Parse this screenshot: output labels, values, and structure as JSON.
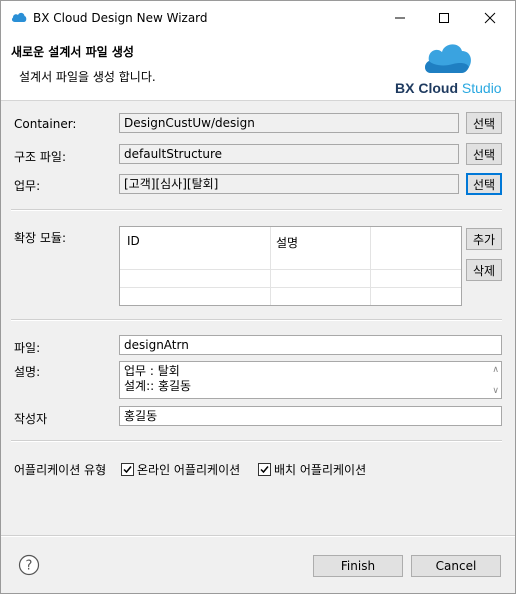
{
  "window": {
    "title": "BX Cloud Design New Wizard"
  },
  "header": {
    "title": "새로운 설계서 파일 생성",
    "description": "설계서 파일을 생성 합니다.",
    "logo_main": "BX Cloud ",
    "logo_accent": "Studio"
  },
  "form": {
    "container_label": "Container:",
    "container_value": "DesignCustUw/design",
    "structure_label": "구조 파일:",
    "structure_value": "defaultStructure",
    "business_label": "업무:",
    "business_value": "[고객][심사][탈회]",
    "select_button": "선택",
    "modules_label": "확장 모듈:",
    "modules_columns": [
      "ID",
      "설명"
    ],
    "add_button": "추가",
    "delete_button": "삭제",
    "file_label": "파일:",
    "file_value": "designAtrn",
    "desc_label": "설명:",
    "desc_lines": [
      "업무 : 탈회",
      "설계:: 홍길동"
    ],
    "author_label": "작성자",
    "author_value": "홍길동",
    "apptype_label": "어플리케이션 유형",
    "online_label": "온라인 어플리케이션",
    "online_checked": true,
    "batch_label": "배치 어플리케이션",
    "batch_checked": true
  },
  "footer": {
    "finish": "Finish",
    "cancel": "Cancel"
  }
}
